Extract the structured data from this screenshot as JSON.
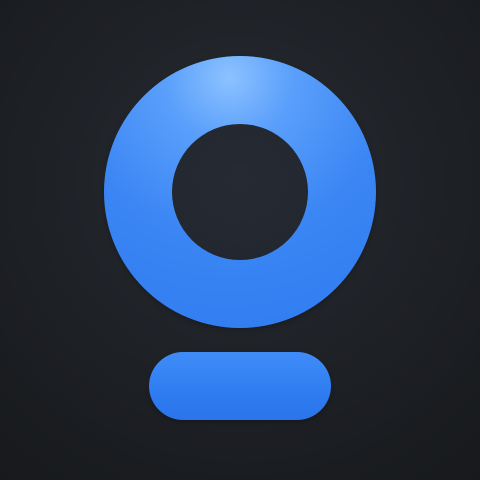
{
  "app_icon": {
    "colors": {
      "background": "#1f2227",
      "accent": "#3b86f4",
      "accent_highlight": "#8cc2ff",
      "inner": "#232830"
    },
    "icon_name": "webcam-logo-icon"
  }
}
